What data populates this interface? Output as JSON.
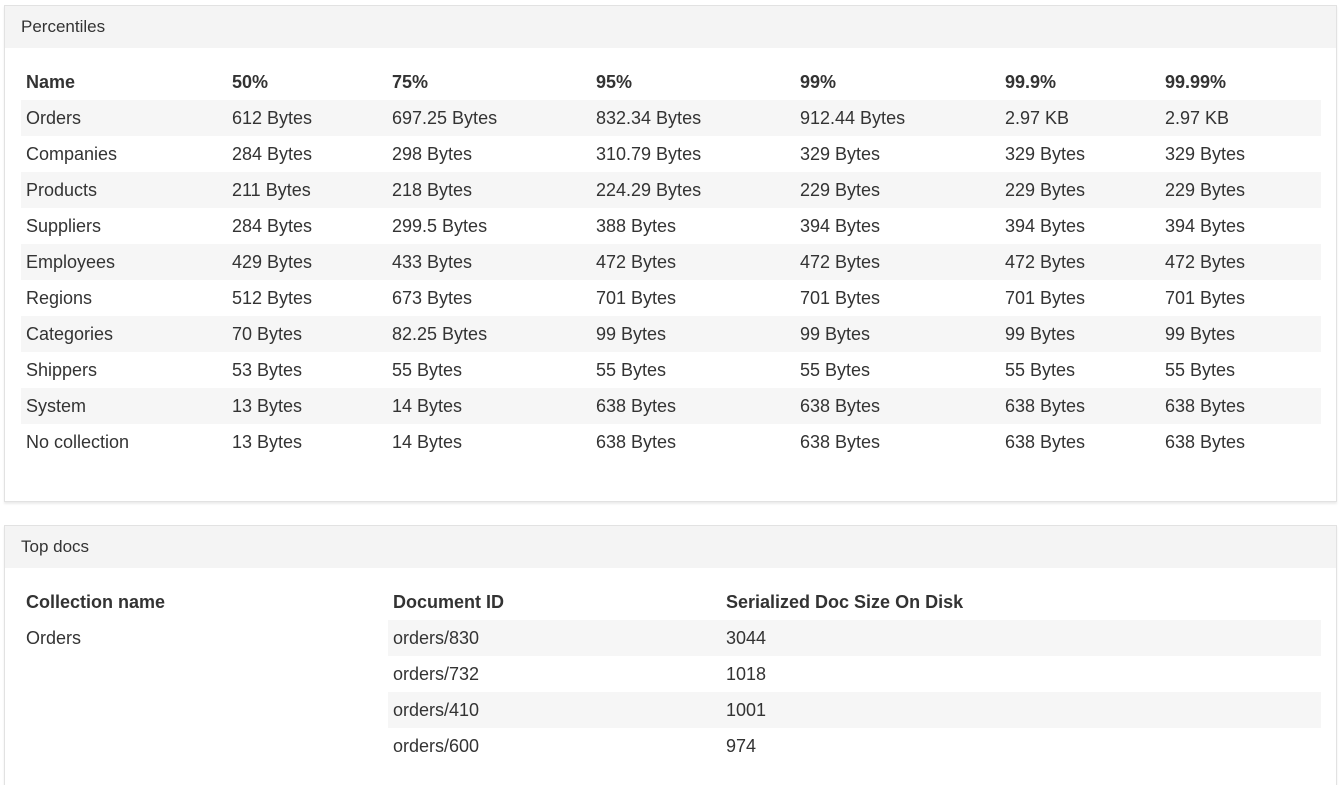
{
  "percentiles": {
    "title": "Percentiles",
    "columns": [
      "Name",
      "50%",
      "75%",
      "95%",
      "99%",
      "99.9%",
      "99.99%"
    ],
    "rows": [
      [
        "Orders",
        "612 Bytes",
        "697.25 Bytes",
        "832.34 Bytes",
        "912.44 Bytes",
        "2.97 KB",
        "2.97 KB"
      ],
      [
        "Companies",
        "284 Bytes",
        "298 Bytes",
        "310.79 Bytes",
        "329 Bytes",
        "329 Bytes",
        "329 Bytes"
      ],
      [
        "Products",
        "211 Bytes",
        "218 Bytes",
        "224.29 Bytes",
        "229 Bytes",
        "229 Bytes",
        "229 Bytes"
      ],
      [
        "Suppliers",
        "284 Bytes",
        "299.5 Bytes",
        "388 Bytes",
        "394 Bytes",
        "394 Bytes",
        "394 Bytes"
      ],
      [
        "Employees",
        "429 Bytes",
        "433 Bytes",
        "472 Bytes",
        "472 Bytes",
        "472 Bytes",
        "472 Bytes"
      ],
      [
        "Regions",
        "512 Bytes",
        "673 Bytes",
        "701 Bytes",
        "701 Bytes",
        "701 Bytes",
        "701 Bytes"
      ],
      [
        "Categories",
        "70 Bytes",
        "82.25 Bytes",
        "99 Bytes",
        "99 Bytes",
        "99 Bytes",
        "99 Bytes"
      ],
      [
        "Shippers",
        "53 Bytes",
        "55 Bytes",
        "55 Bytes",
        "55 Bytes",
        "55 Bytes",
        "55 Bytes"
      ],
      [
        "System",
        "13 Bytes",
        "14 Bytes",
        "638 Bytes",
        "638 Bytes",
        "638 Bytes",
        "638 Bytes"
      ],
      [
        "No collection",
        "13 Bytes",
        "14 Bytes",
        "638 Bytes",
        "638 Bytes",
        "638 Bytes",
        "638 Bytes"
      ]
    ]
  },
  "top_docs": {
    "title": "Top docs",
    "columns": [
      "Collection name",
      "Document ID",
      "Serialized Doc Size On Disk"
    ],
    "collection": "Orders",
    "rows": [
      [
        "orders/830",
        "3044"
      ],
      [
        "orders/732",
        "1018"
      ],
      [
        "orders/410",
        "1001"
      ],
      [
        "orders/600",
        "974"
      ]
    ]
  }
}
